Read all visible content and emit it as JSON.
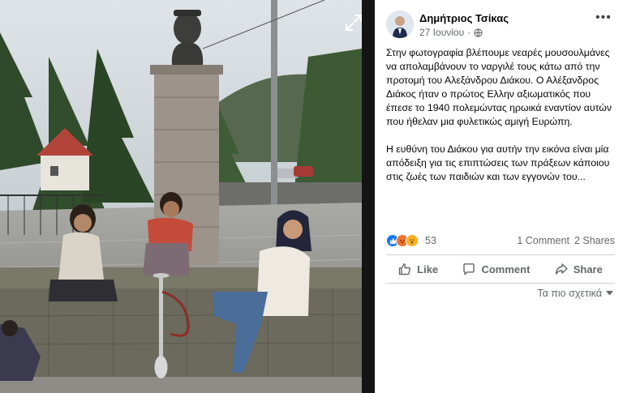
{
  "post": {
    "author": "Δημήτριος Τσίκας",
    "date": "27 Ιουνίου",
    "meta_separator": "·",
    "paragraphs": [
      "Στην φωτογραφία βλέπουμε νεαρές μουσουλμάνες να απολαμβάνουν το ναργιλέ τους κάτω από την προτομή του Αλεξάνδρου Διάκου. Ο Αλέξανδρος Διάκος ήταν ο πρώτος Ελλην αξιωματικός που έπεσε το 1940 πολεμώντας ηρωικά εναντίον αυτών που ήθελαν μια φυλετικώς αμιγή Ευρώπη.",
      "Η ευθύνη του Διάκου για αυτήν την εικόνα είναι μία απόδειξη για τις επιπτώσεις των πράξεων κάποιου στις ζωές των παιδιών και των εγγονών του..."
    ],
    "more_icon": "more-dots-icon",
    "privacy_icon": "globe-icon"
  },
  "stats": {
    "reaction_icons": [
      "like-reaction-icon",
      "angry-reaction-icon",
      "wow-reaction-icon"
    ],
    "reaction_count": "53",
    "comments": "1 Comment",
    "shares": "2 Shares"
  },
  "actions": {
    "like": "Like",
    "comment": "Comment",
    "share": "Share"
  },
  "sort": {
    "label": "Τα πιο σχετικά",
    "icon": "caret-down-icon"
  },
  "colors": {
    "brand_blue": "#1877f2",
    "text_secondary": "#65676b",
    "divider": "#ced0d4",
    "viewer_bg": "#141414"
  }
}
